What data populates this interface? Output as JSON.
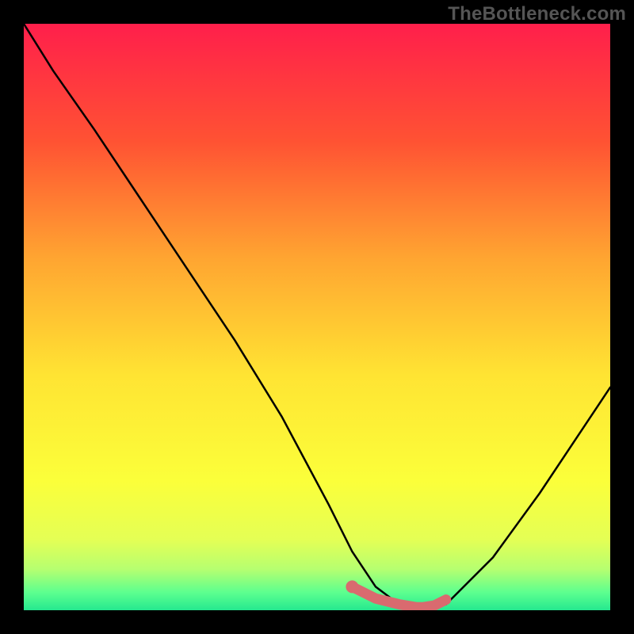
{
  "watermark": "TheBottleneck.com",
  "chart_data": {
    "type": "line",
    "title": "",
    "xlabel": "",
    "ylabel": "",
    "xlim": [
      0,
      100
    ],
    "ylim": [
      0,
      100
    ],
    "series": [
      {
        "name": "bottleneck-curve",
        "x": [
          0,
          5,
          12,
          20,
          28,
          36,
          44,
          52,
          56,
          60,
          64,
          68,
          72,
          80,
          88,
          96,
          100
        ],
        "values": [
          100,
          92,
          82,
          70,
          58,
          46,
          33,
          18,
          10,
          4,
          1,
          0,
          1,
          9,
          20,
          32,
          38
        ]
      }
    ],
    "highlight_segment": {
      "name": "optimal-range",
      "x": [
        56,
        60,
        64,
        67,
        68,
        70,
        72
      ],
      "values": [
        4,
        2,
        1,
        0.5,
        0.5,
        0.8,
        1.8
      ]
    },
    "background_gradient_stops": [
      {
        "offset": 0.0,
        "color": "#ff1f4b"
      },
      {
        "offset": 0.2,
        "color": "#ff5233"
      },
      {
        "offset": 0.4,
        "color": "#ffa531"
      },
      {
        "offset": 0.6,
        "color": "#ffe433"
      },
      {
        "offset": 0.78,
        "color": "#fbff3a"
      },
      {
        "offset": 0.88,
        "color": "#e4ff55"
      },
      {
        "offset": 0.93,
        "color": "#b6ff70"
      },
      {
        "offset": 0.97,
        "color": "#5cff8f"
      },
      {
        "offset": 1.0,
        "color": "#25e88f"
      }
    ],
    "curve_color": "#000000",
    "highlight_color": "#d96a6f"
  }
}
